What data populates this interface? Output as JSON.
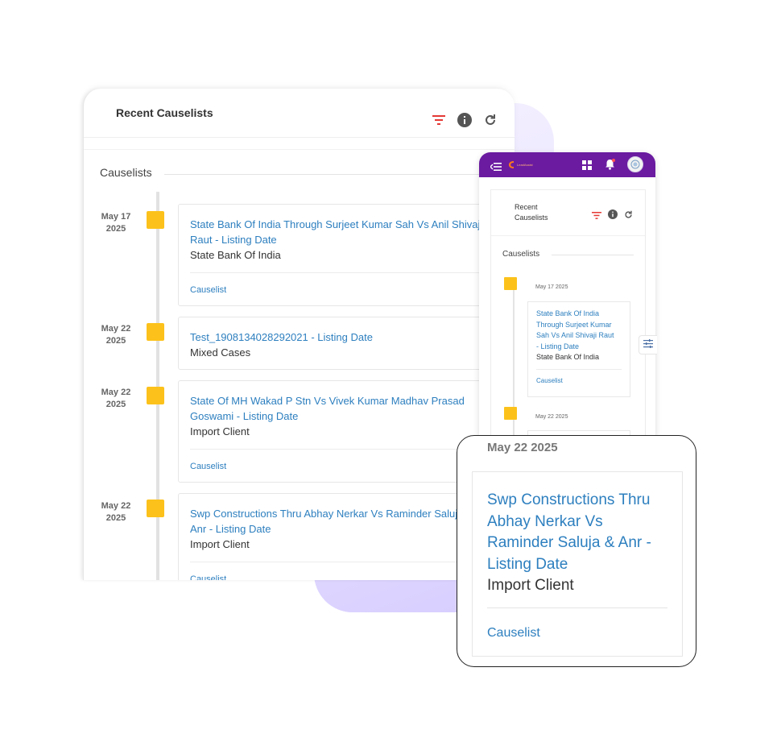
{
  "colors": {
    "accent": "#2d7fbf",
    "marker": "#fcc21b",
    "filter_icon": "#e53935",
    "mobile_bar": "#6a1ba0"
  },
  "desktop": {
    "title": "Recent Causelists",
    "section": "Causelists",
    "icons": [
      "filter-icon",
      "info-icon",
      "refresh-icon"
    ],
    "items": [
      {
        "date_md": "May 17",
        "date_y": "2025",
        "title_line1": "State Bank Of India Through Surjeet Kumar Sah Vs Anil Shivaji",
        "title_line2": "Raut - Listing Date",
        "subtitle": "State Bank Of India",
        "link": "Causelist"
      },
      {
        "date_md": "May 22",
        "date_y": "2025",
        "title_line1": "Test_1908134028292021 - Listing Date",
        "subtitle": "Mixed Cases"
      },
      {
        "date_md": "May 22",
        "date_y": "2025",
        "title_line1": "State Of MH Wakad P Stn Vs Vivek Kumar Madhav Prasad",
        "title_line2": "Goswami - Listing Date",
        "subtitle": "Import Client",
        "link": "Causelist"
      },
      {
        "date_md": "May 22",
        "date_y": "2025",
        "title_line1": "Swp Constructions Thru Abhay Nerkar Vs Raminder Saluja &",
        "title_line2": "Anr - Listing Date",
        "subtitle": "Import Client",
        "link": "Causelist"
      }
    ]
  },
  "mobile": {
    "brand": "LeadAssist",
    "title_line1": "Recent",
    "title_line2": "Causelists",
    "section": "Causelists",
    "items": [
      {
        "date": "May 17 2025",
        "title_lines": [
          "State Bank Of India",
          "Through Surjeet Kumar",
          "Sah Vs Anil Shivaji Raut",
          "- Listing Date"
        ],
        "subtitle": "State Bank Of India",
        "link": "Causelist"
      },
      {
        "date": "May 22 2025"
      }
    ]
  },
  "zoom": {
    "date": "May 22 2025",
    "title_lines": [
      "Swp Constructions Thru",
      "Abhay Nerkar Vs",
      "Raminder Saluja & Anr -",
      "Listing Date"
    ],
    "subtitle": "Import Client",
    "link": "Causelist"
  }
}
